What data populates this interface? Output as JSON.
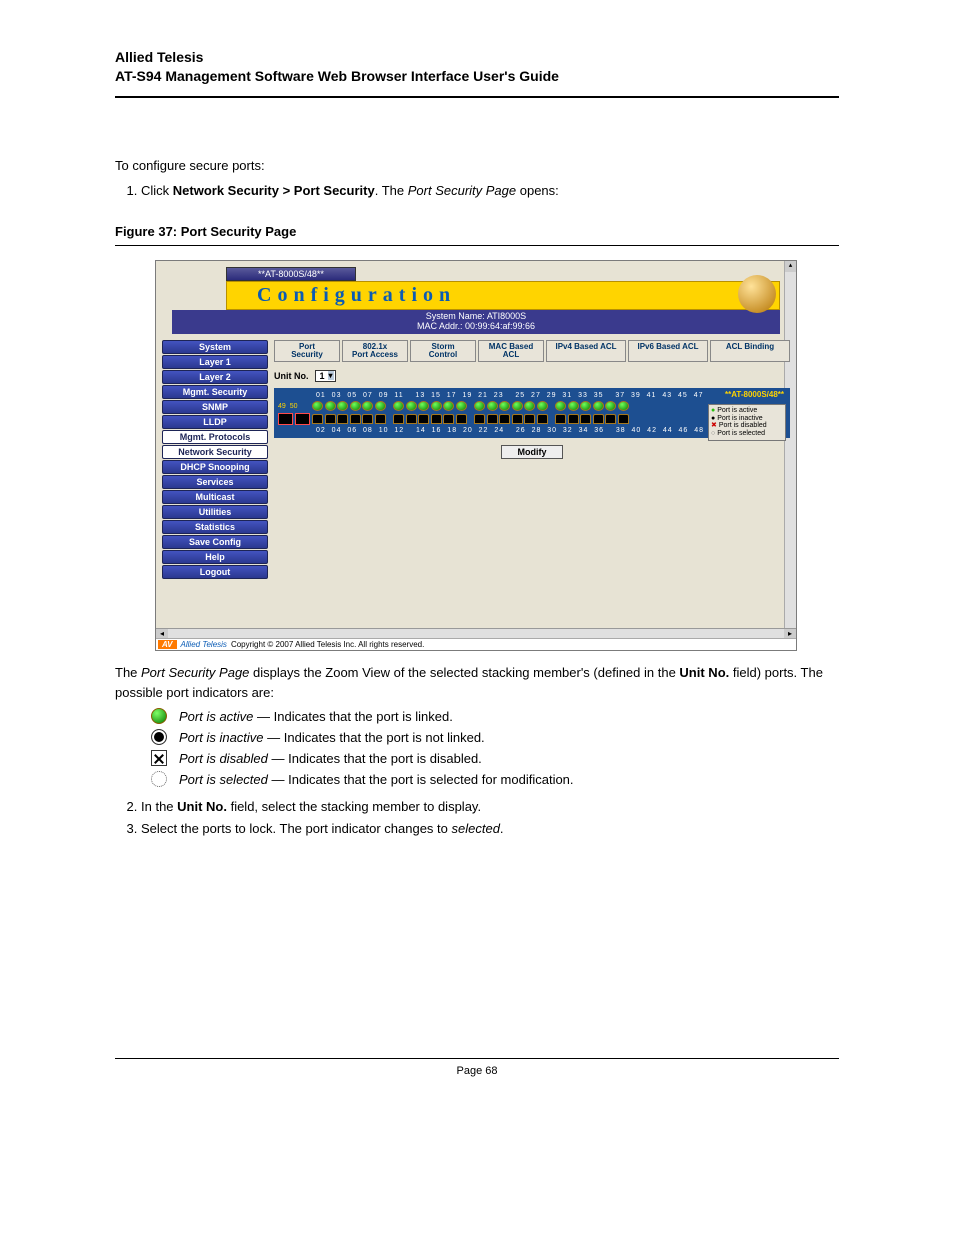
{
  "header": {
    "brand": "Allied Telesis",
    "subtitle": "AT-S94 Management Software Web Browser Interface User's Guide"
  },
  "intro": "To configure secure ports:",
  "step1_pre": "Click ",
  "step1_bold": "Network Security > Port Security",
  "step1_mid": ". The ",
  "step1_ital": "Port Security Page",
  "step1_post": " opens:",
  "figcap": "Figure 37:  Port Security Page",
  "shot": {
    "title": "**AT-8000S/48**",
    "banner": "Configuration",
    "sys1": "System Name: ATI8000S",
    "sys2": "MAC Addr.: 00:99:64:af:99:66",
    "nav": [
      "System",
      "Layer 1",
      "Layer 2",
      "Mgmt. Security",
      "SNMP",
      "LLDP",
      "Mgmt. Protocols",
      "Network Security",
      "DHCP Snooping",
      "Services",
      "Multicast",
      "Utilities",
      "Statistics",
      "Save Config",
      "Help",
      "Logout"
    ],
    "nav_white_idx": [
      6,
      7
    ],
    "tabs": [
      {
        "l1": "Port",
        "l2": "Security"
      },
      {
        "l1": "802.1x",
        "l2": "Port Access"
      },
      {
        "l1": "Storm",
        "l2": "Control"
      },
      {
        "l1": "MAC Based",
        "l2": "ACL"
      },
      {
        "l": "IPv4 Based ACL"
      },
      {
        "l": "IPv6 Based ACL"
      },
      {
        "l": "ACL Binding"
      }
    ],
    "unit_label": "Unit No.",
    "unit_value": "1",
    "model": "**AT-8000S/48**",
    "toprow": "01  03  05  07  09  11    13  15  17  19  21  23    25  27  29  31  33  35    37  39  41  43  45  47",
    "botrow": "02  04  06  08  10  12    14  16  18  20  22  24    26  28  30  32  34  36    38  40  42  44  46  48",
    "uplinks": [
      "49",
      "50"
    ],
    "legend": [
      "Port is active",
      "Port is inactive",
      "Port is disabled",
      "Port is selected"
    ],
    "modify": "Modify",
    "copyright": "Copyright © 2007 Allied Telesis Inc. All rights reserved.",
    "footer_brand": "Allied Telesis"
  },
  "after_pre": "The ",
  "after_ital": "Port Security Page",
  "after_mid": " displays the Zoom View of the selected stacking member's (defined in the ",
  "after_bold": "Unit No.",
  "after_post": " field) ports. The possible port indicators are:",
  "indicators": [
    {
      "name": "Port is active",
      "desc": " — Indicates that the port is linked."
    },
    {
      "name": "Port is inactive",
      "desc": " — Indicates that the port is not linked."
    },
    {
      "name": "Port is disabled",
      "desc": " — Indicates that the port is disabled."
    },
    {
      "name": "Port is selected",
      "desc": " — Indicates that the port is selected for modification."
    }
  ],
  "step2_pre": "In the ",
  "step2_bold": "Unit No.",
  "step2_post": " field, select the stacking member to display.",
  "step3_pre": "Select the ports to lock. The port indicator changes to ",
  "step3_ital": "selected",
  "step3_post": ".",
  "pagefoot": "Page 68"
}
